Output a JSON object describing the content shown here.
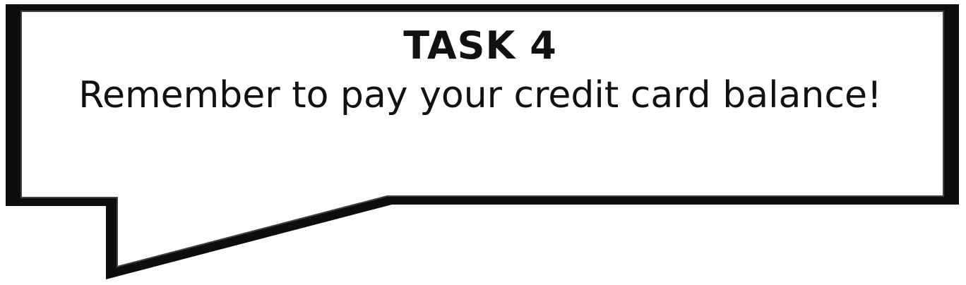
{
  "callout": {
    "title": "TASK 4",
    "message": "Remember to pay your credit card balance!"
  },
  "colors": {
    "border": "#0d0d0d",
    "fill": "#ffffff",
    "text": "#111111"
  }
}
